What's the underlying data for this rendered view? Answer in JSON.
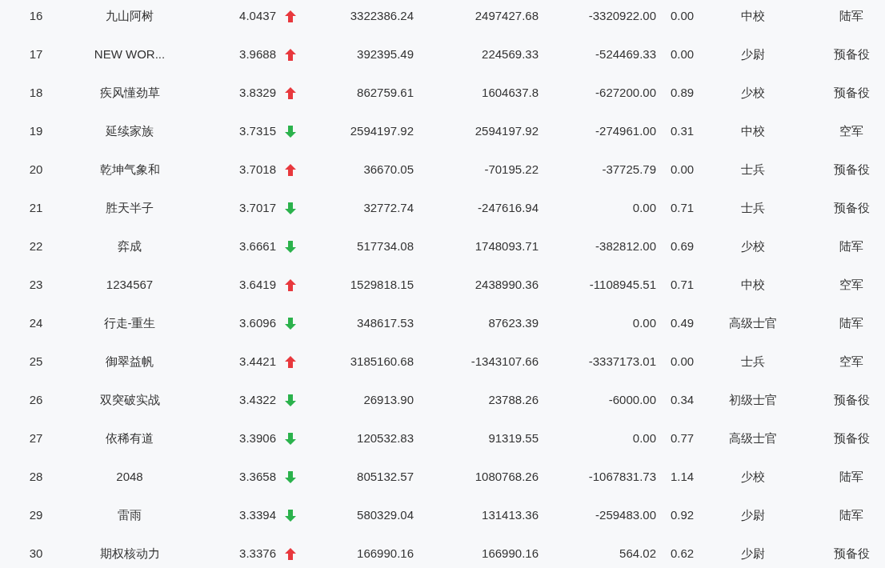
{
  "rows": [
    {
      "rank": "16",
      "name": "九山阿树",
      "score": "4.0437",
      "kind": "up",
      "column_4": "3322386.24",
      "column_5": "2497427.68",
      "column_6": "-3320922.00",
      "column_7": "0.00",
      "rank_title": "中校",
      "branch": "陆军"
    },
    {
      "rank": "17",
      "name": "NEW WOR...",
      "score": "3.9688",
      "kind": "up",
      "column_4": "392395.49",
      "column_5": "224569.33",
      "column_6": "-524469.33",
      "column_7": "0.00",
      "rank_title": "少尉",
      "branch": "预备役"
    },
    {
      "rank": "18",
      "name": "疾风懂劲草",
      "score": "3.8329",
      "kind": "up",
      "column_4": "862759.61",
      "column_5": "1604637.8",
      "column_6": "-627200.00",
      "column_7": "0.89",
      "rank_title": "少校",
      "branch": "预备役"
    },
    {
      "rank": "19",
      "name": "延续家族",
      "score": "3.7315",
      "kind": "down",
      "column_4": "2594197.92",
      "column_5": "2594197.92",
      "column_6": "-274961.00",
      "column_7": "0.31",
      "rank_title": "中校",
      "branch": "空军"
    },
    {
      "rank": "20",
      "name": "乾坤气象和",
      "score": "3.7018",
      "kind": "up",
      "column_4": "36670.05",
      "column_5": "-70195.22",
      "column_6": "-37725.79",
      "column_7": "0.00",
      "rank_title": "士兵",
      "branch": "预备役"
    },
    {
      "rank": "21",
      "name": "胜天半子",
      "score": "3.7017",
      "kind": "down",
      "column_4": "32772.74",
      "column_5": "-247616.94",
      "column_6": "0.00",
      "column_7": "0.71",
      "rank_title": "士兵",
      "branch": "预备役"
    },
    {
      "rank": "22",
      "name": "弈成",
      "score": "3.6661",
      "kind": "down",
      "column_4": "517734.08",
      "column_5": "1748093.71",
      "column_6": "-382812.00",
      "column_7": "0.69",
      "rank_title": "少校",
      "branch": "陆军"
    },
    {
      "rank": "23",
      "name": "1234567",
      "score": "3.6419",
      "kind": "up",
      "column_4": "1529818.15",
      "column_5": "2438990.36",
      "column_6": "-1108945.51",
      "column_7": "0.71",
      "rank_title": "中校",
      "branch": "空军"
    },
    {
      "rank": "24",
      "name": "行走-重生",
      "score": "3.6096",
      "kind": "down",
      "column_4": "348617.53",
      "column_5": "87623.39",
      "column_6": "0.00",
      "column_7": "0.49",
      "rank_title": "高级士官",
      "branch": "陆军"
    },
    {
      "rank": "25",
      "name": "御翠益帆",
      "score": "3.4421",
      "kind": "up",
      "column_4": "3185160.68",
      "column_5": "-1343107.66",
      "column_6": "-3337173.01",
      "column_7": "0.00",
      "rank_title": "士兵",
      "branch": "空军"
    },
    {
      "rank": "26",
      "name": "双突破实战",
      "score": "3.4322",
      "kind": "down",
      "column_4": "26913.90",
      "column_5": "23788.26",
      "column_6": "-6000.00",
      "column_7": "0.34",
      "rank_title": "初级士官",
      "branch": "预备役"
    },
    {
      "rank": "27",
      "name": "依稀有道",
      "score": "3.3906",
      "kind": "down",
      "column_4": "120532.83",
      "column_5": "91319.55",
      "column_6": "0.00",
      "column_7": "0.77",
      "rank_title": "高级士官",
      "branch": "预备役"
    },
    {
      "rank": "28",
      "name": "2048",
      "score": "3.3658",
      "kind": "down",
      "column_4": "805132.57",
      "column_5": "1080768.26",
      "column_6": "-1067831.73",
      "column_7": "1.14",
      "rank_title": "少校",
      "branch": "陆军"
    },
    {
      "rank": "29",
      "name": "雷雨",
      "score": "3.3394",
      "kind": "down",
      "column_4": "580329.04",
      "column_5": "131413.36",
      "column_6": "-259483.00",
      "column_7": "0.92",
      "rank_title": "少尉",
      "branch": "陆军"
    },
    {
      "rank": "30",
      "name": "期权核动力",
      "score": "3.3376",
      "kind": "up",
      "column_4": "166990.16",
      "column_5": "166990.16",
      "column_6": "564.02",
      "column_7": "0.62",
      "rank_title": "少尉",
      "branch": "预备役"
    }
  ]
}
